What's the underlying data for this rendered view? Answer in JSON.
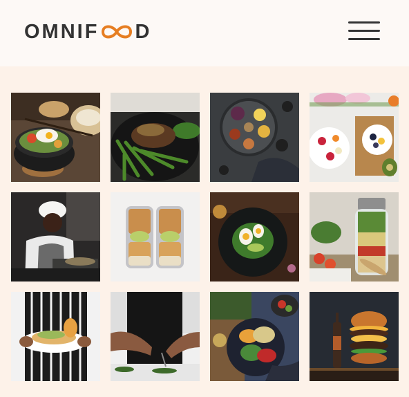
{
  "header": {
    "logo": {
      "prefix": "OMNIF",
      "suffix": "D",
      "brand_color": "#e67e22"
    },
    "menu_icon": "hamburger-menu-icon"
  },
  "gallery": {
    "photos": [
      "bibimbap-bowl-photo",
      "steak-green-beans-photo",
      "mezze-platter-photo",
      "fruit-breakfast-photo",
      "chef-plating-photo",
      "meal-prep-containers-photo",
      "egg-salad-plate-photo",
      "jar-salad-photo",
      "sandwich-plate-photo",
      "chef-garnishing-photo",
      "grain-bowl-table-photo",
      "stacked-burger-photo"
    ]
  }
}
